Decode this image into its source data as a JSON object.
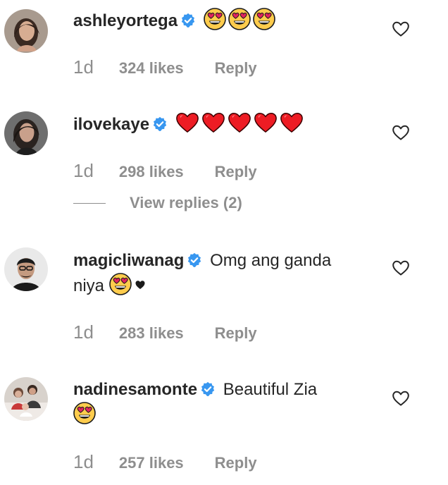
{
  "colors": {
    "text": "#262626",
    "muted": "#8e8e8e",
    "verified": "#3897f0",
    "heart_red": "#ed1c24"
  },
  "comments": [
    {
      "username": "ashleyortega",
      "text": "",
      "emojis": [
        "heart-eyes-emoji",
        "heart-eyes-emoji",
        "heart-eyes-emoji"
      ],
      "time": "1d",
      "likes": "324 likes",
      "reply": "Reply"
    },
    {
      "username": "ilovekaye",
      "text": "",
      "emojis": [
        "red-heart-emoji",
        "red-heart-emoji",
        "red-heart-emoji",
        "red-heart-emoji",
        "red-heart-emoji"
      ],
      "time": "1d",
      "likes": "298 likes",
      "reply": "Reply",
      "view_replies": "View replies (2)"
    },
    {
      "username": "magicliwanag",
      "text_line1": "Omg ang ganda",
      "text_line2": "niya",
      "emojis": [
        "heart-eyes-emoji",
        "black-heart-emoji"
      ],
      "time": "1d",
      "likes": "283 likes",
      "reply": "Reply"
    },
    {
      "username": "nadinesamonte",
      "text": "Beautiful Zia",
      "emojis": [
        "heart-eyes-emoji"
      ],
      "time": "1d",
      "likes": "257 likes",
      "reply": "Reply"
    }
  ]
}
